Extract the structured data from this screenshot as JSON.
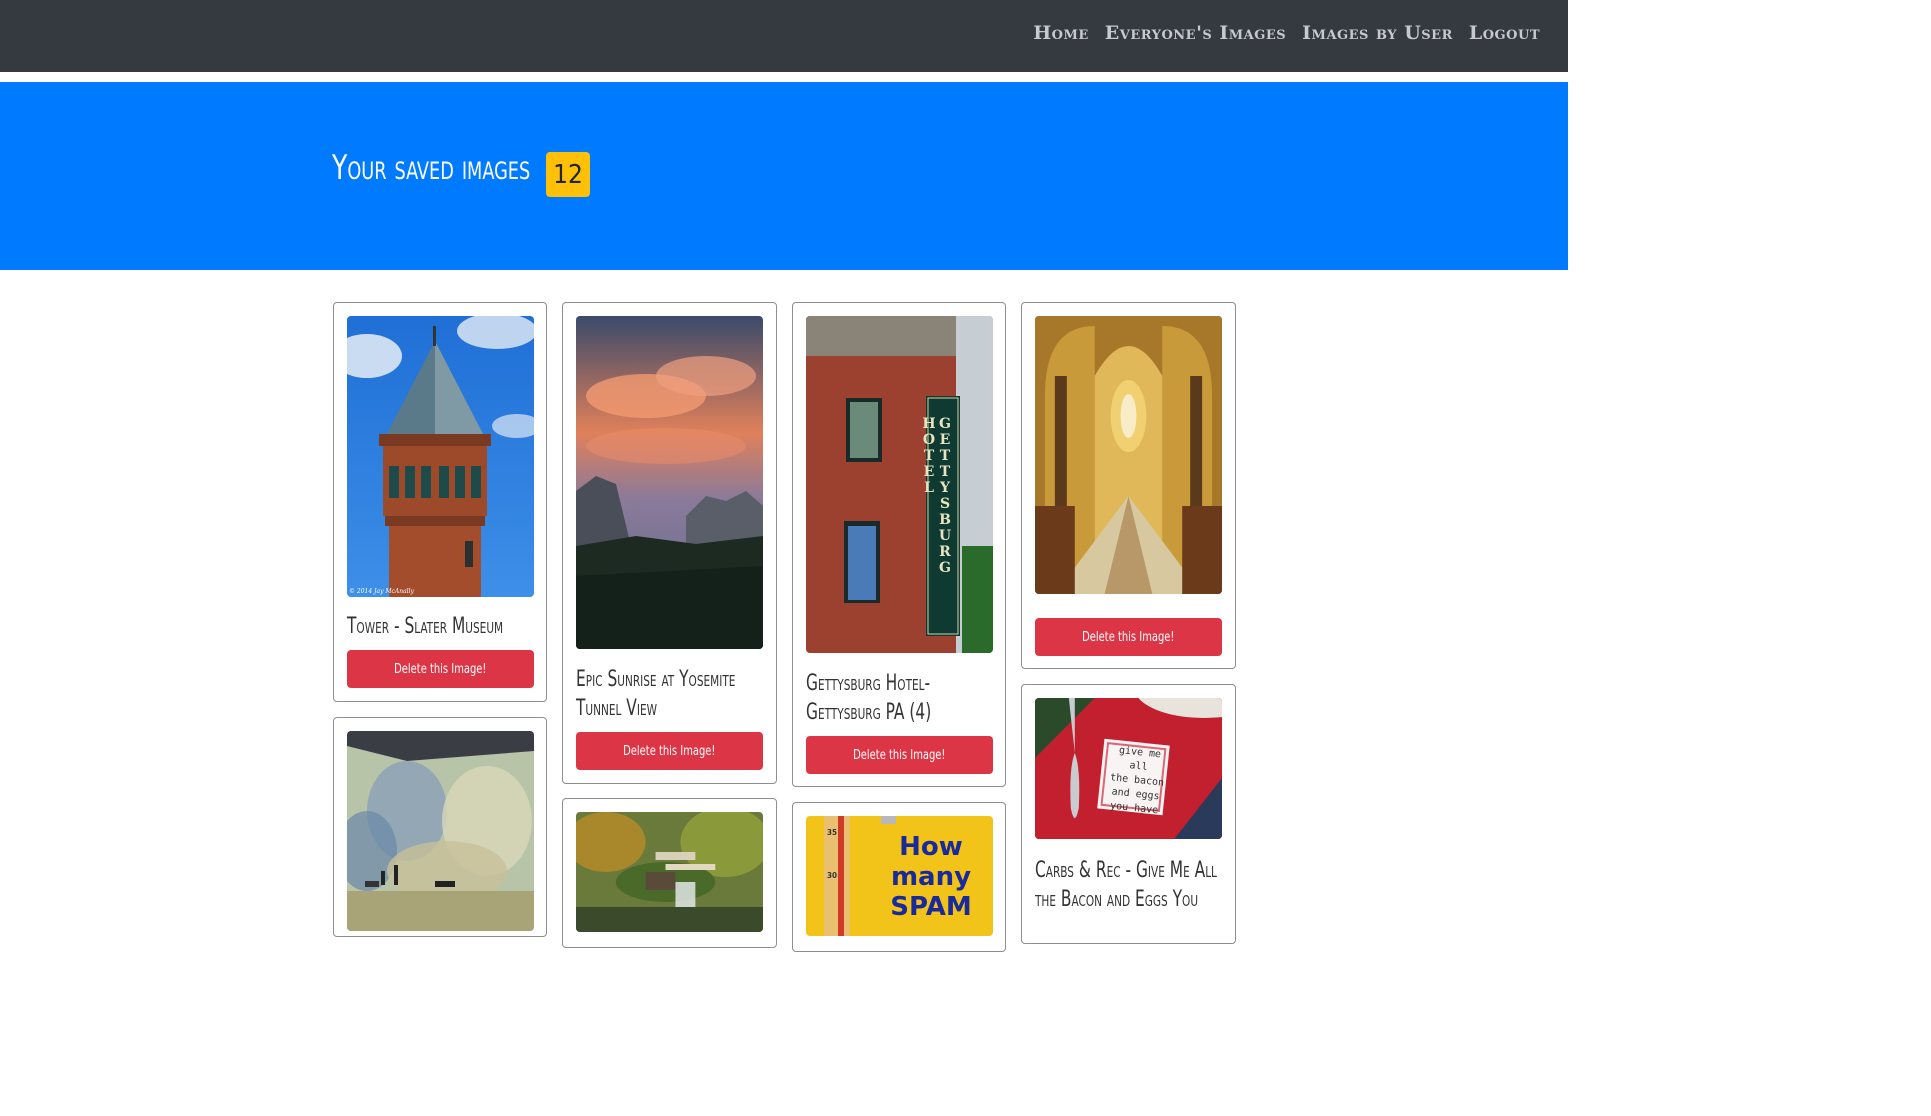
{
  "nav": {
    "links": [
      "Home",
      "Everyone's Images",
      "Images by User",
      "Logout"
    ]
  },
  "header": {
    "title": "Your saved images",
    "count": "12"
  },
  "cards": [
    {
      "title_line1": "Tower - Slater Museum",
      "title_line2": "",
      "delete_label": "Delete this Image!",
      "watermark": "© 2014 Jay McAnally"
    },
    {
      "title_line1": "Epic Sunrise at Yosemite",
      "title_line2": "Tunnel View",
      "delete_label": "Delete this Image!"
    },
    {
      "title_line1": "Gettysburg Hotel-",
      "title_line2": "Gettysburg PA (4)",
      "delete_label": "Delete this Image!",
      "sign_text": "GETTYSBURG HOTEL"
    },
    {
      "title_line1": "",
      "title_line2": "",
      "delete_label": "Delete this Image!"
    },
    {
      "title_line1": "",
      "title_line2": "",
      "delete_label": ""
    },
    {
      "title_line1": "",
      "title_line2": "",
      "delete_label": ""
    },
    {
      "title_line1": "",
      "title_line2": "",
      "delete_label": "",
      "poster_text": [
        "How",
        "many",
        "SPAM"
      ],
      "ruler_marks": [
        "35",
        "30"
      ]
    },
    {
      "title_line1": "Carbs & Rec - Give Me All",
      "title_line2": "the Bacon and Eggs You",
      "delete_label": "",
      "note_text": [
        "give me all",
        "the bacon",
        "and eggs",
        "you have"
      ]
    }
  ],
  "colors": {
    "navbar": "#343a40",
    "jumbotron": "#007bff",
    "badge": "#ffc107",
    "delete_button": "#dc3545"
  }
}
